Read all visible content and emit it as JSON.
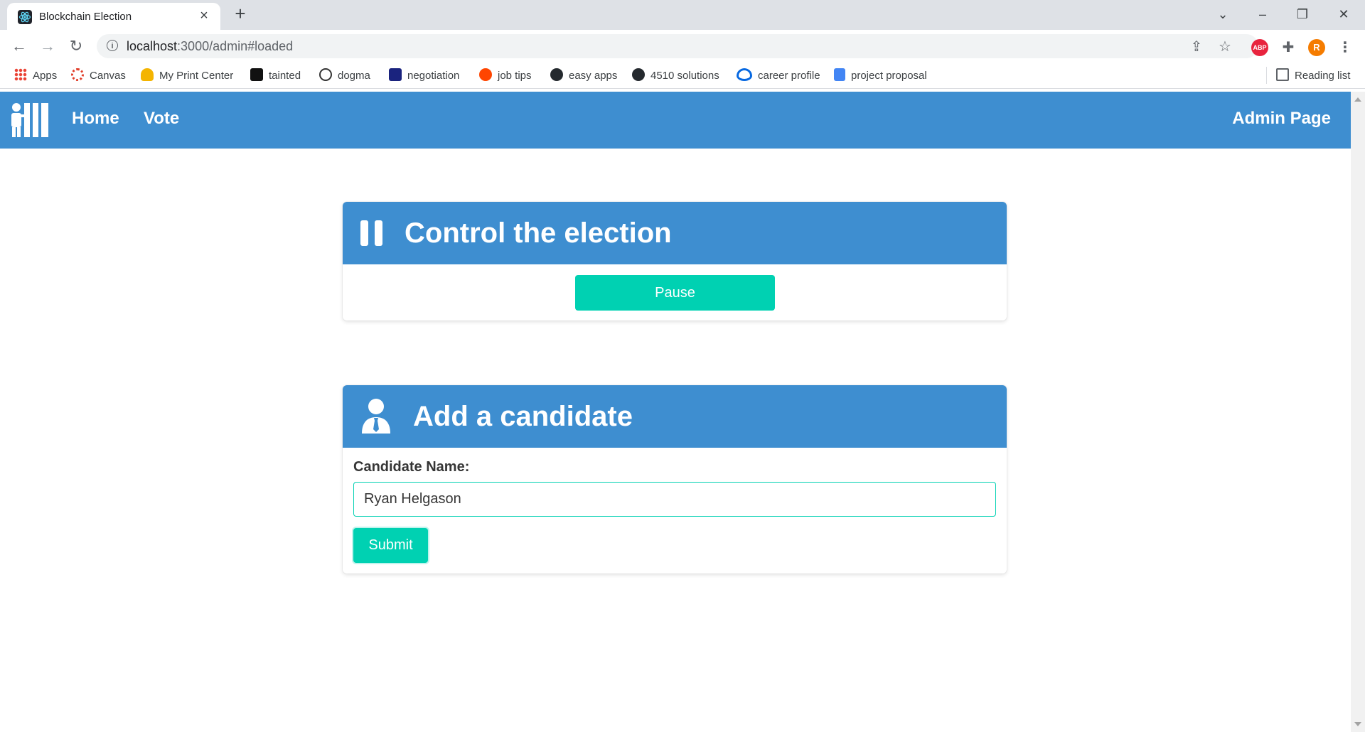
{
  "browser": {
    "tab_title": "Blockchain Election",
    "url_host": "localhost",
    "url_rest": ":3000/admin#loaded",
    "profile_initial": "R",
    "abp_label": "ABP",
    "reading_list": "Reading list",
    "bookmarks": [
      "Apps",
      "Canvas",
      "My Print Center",
      "tainted",
      "dogma",
      "negotiation",
      "job tips",
      "easy apps",
      "4510 solutions",
      "career profile",
      "project proposal"
    ]
  },
  "navbar": {
    "home": "Home",
    "vote": "Vote",
    "admin": "Admin Page"
  },
  "control_card": {
    "title": "Control the election",
    "button": "Pause"
  },
  "candidate_card": {
    "title": "Add a candidate",
    "label": "Candidate Name:",
    "input_value": "Ryan Helgason",
    "submit": "Submit"
  },
  "colors": {
    "primary": "#3e8ed0",
    "accent": "#00d1b2"
  }
}
